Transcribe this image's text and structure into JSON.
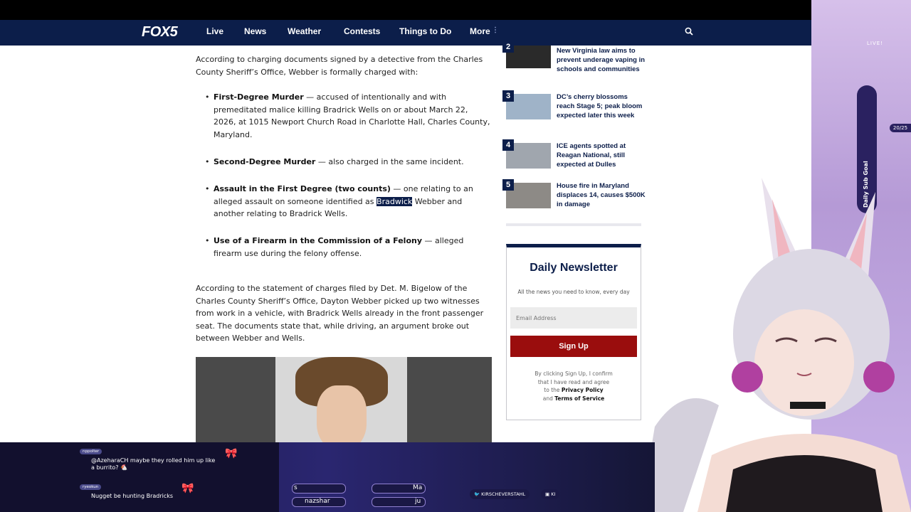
{
  "nav": {
    "logo": "FOX5",
    "items": [
      "Live",
      "News",
      "Weather",
      "Contests",
      "Things to Do",
      "More"
    ]
  },
  "article": {
    "intro": "According to charging documents signed by a detective from the Charles County Sheriff’s Office, Webber is formally charged with:",
    "charges": [
      {
        "title": "First-Degree Murder",
        "text": " — accused of intentionally and with premeditated malice killing Bradrick Wells on or about March 22, 2026, at 1015 Newport Church Road in Charlotte Hall, Charles County, Maryland."
      },
      {
        "title": "Second-Degree Murder",
        "text": " — also charged in the same incident."
      },
      {
        "title": "Assault in the First Degree (two counts)",
        "text_before": " — one relating to an alleged assault on someone identified as ",
        "highlight": "Bradwick",
        "text_after": " Webber and another relating to Bradrick Wells."
      },
      {
        "title": "Use of a Firearm in the Commission of a Felony",
        "text": " — alleged firearm use during the felony offense."
      }
    ],
    "paragraph2": "According to the statement of charges filed by Det. M. Bigelow of the Charles County Sheriff’s Office, Dayton Webber picked up two witnesses from work in a vehicle, with Bradrick Wells already in the front passenger seat. The documents state that, while driving, an argument broke out between Webber and Wells."
  },
  "trending": [
    {
      "num": "2",
      "title": "New Virginia law aims to prevent underage vaping in schools and communities"
    },
    {
      "num": "3",
      "title": "DC’s cherry blossoms reach Stage 5; peak bloom expected later this week"
    },
    {
      "num": "4",
      "title": "ICE agents spotted at Reagan National, still expected at Dulles"
    },
    {
      "num": "5",
      "title": "House fire in Maryland displaces 14, causes $500K in damage"
    }
  ],
  "newsletter": {
    "title": "Daily Newsletter",
    "subtitle": "All the news you need to know, every day",
    "email_placeholder": "Email Address",
    "button": "Sign Up",
    "legal_1": "By clicking Sign Up, I confirm",
    "legal_2": "that I have read and agree",
    "legal_3": "to the",
    "privacy": "Privacy Policy",
    "legal_4": "and",
    "terms": "Terms of Service"
  },
  "overlay": {
    "live": "LIVE!",
    "goal_label": "Daily Sub Goal",
    "goal_count": "20/25",
    "chat": [
      {
        "user": "nppolter",
        "message_1": "@AzeharaCH maybe they rolled him up like",
        "message_2": "a burrito? 🐔"
      },
      {
        "user": "ryeokun",
        "message_1": "Nugget be hunting Bradricks",
        "message_2": ""
      }
    ],
    "slots": [
      "s",
      "Ma",
      "nazshar",
      "ju"
    ],
    "socials": [
      "KIRSCHEVERSTAHL",
      "KI"
    ]
  }
}
